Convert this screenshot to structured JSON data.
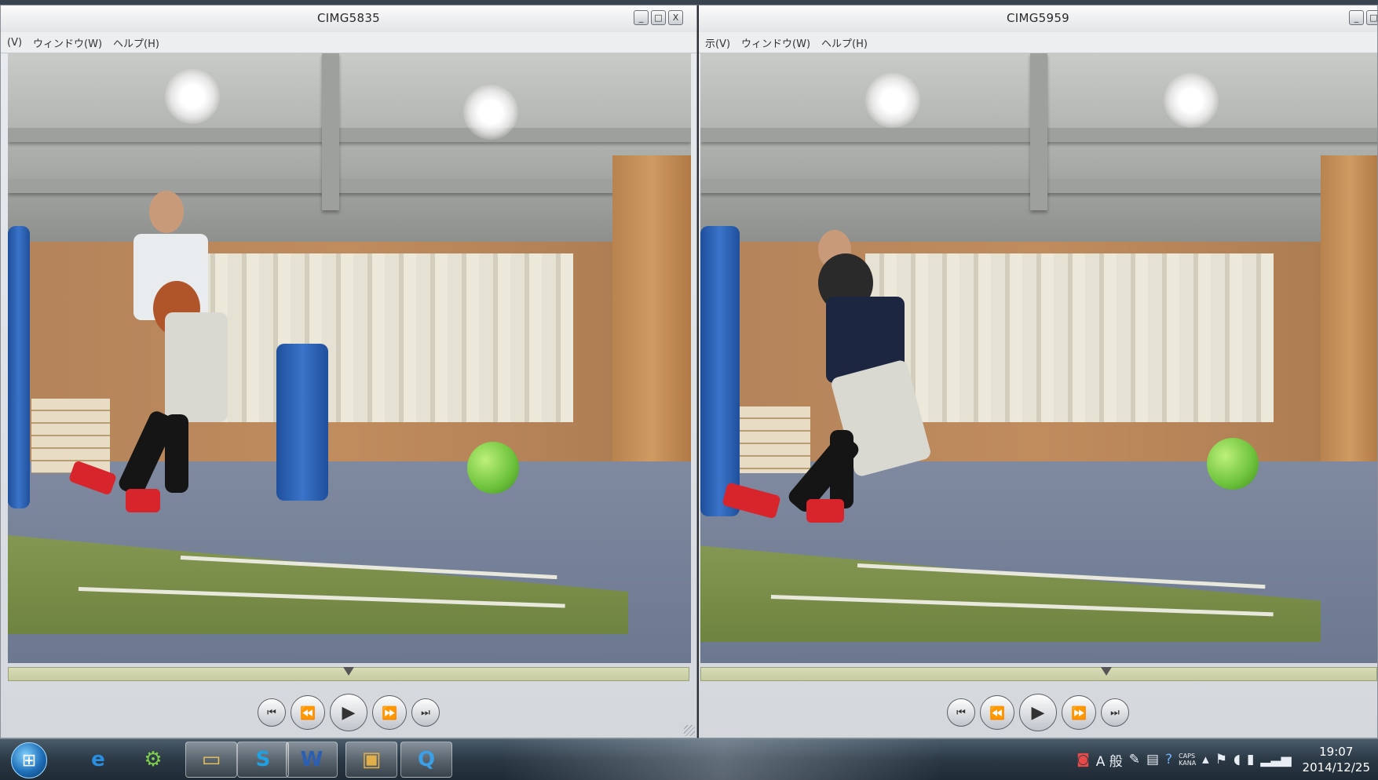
{
  "left_window": {
    "title": "CIMG5835",
    "menu": [
      "(V)",
      "ウィンドウ(W)",
      "ヘルプ(H)"
    ],
    "buttons": [
      "_",
      "□",
      "X"
    ],
    "playhead_fraction": 0.5
  },
  "right_window": {
    "title": "CIMG5959",
    "menu": [
      "示(V)",
      "ウィンドウ(W)",
      "ヘルプ(H)"
    ],
    "buttons": [
      "_",
      "□"
    ],
    "playhead_fraction": 0.6
  },
  "controls": {
    "skip_back": "⏮",
    "rewind": "⏪",
    "play": "▶",
    "fast_forward": "⏩",
    "skip_forward": "⏭"
  },
  "taskbar": {
    "start_icon": "windows-orb",
    "apps": [
      {
        "name": "ie-icon",
        "glyph": "e",
        "color": "#2a8fe0"
      },
      {
        "name": "network-icon",
        "glyph": "⚙",
        "color": "#7fcf4a"
      },
      {
        "name": "folder-icon",
        "glyph": "▭",
        "color": "#e8c45a"
      },
      {
        "name": "skype-icon",
        "glyph": "S",
        "color": "#1ea2e3"
      },
      {
        "name": "word-icon",
        "glyph": "W",
        "color": "#2b5fb4"
      },
      {
        "name": "media-icon",
        "glyph": "▣",
        "color": "#e2b04a"
      },
      {
        "name": "quicktime-icon",
        "glyph": "Q",
        "color": "#3aa0e8"
      }
    ],
    "tray": {
      "ime_label": "A 般",
      "caps": "CAPS",
      "kana": "KANA",
      "time": "19:07",
      "date": "2014/12/25"
    }
  }
}
